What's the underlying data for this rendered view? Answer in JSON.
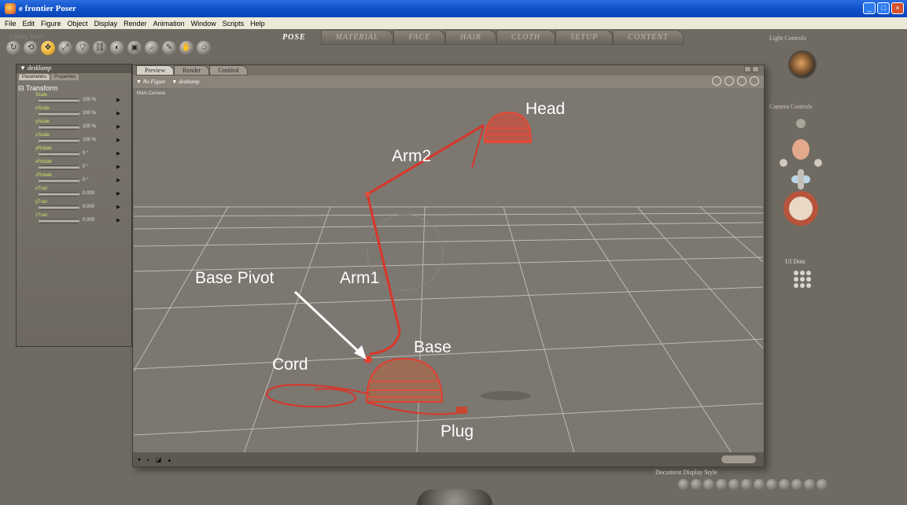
{
  "window": {
    "title": "e frontier Poser"
  },
  "menu": [
    "File",
    "Edit",
    "Figure",
    "Object",
    "Display",
    "Render",
    "Animation",
    "Window",
    "Scripts",
    "Help"
  ],
  "toolbar": {
    "label": "Editing Tools",
    "tools": [
      "rotate",
      "twist",
      "translate",
      "scale",
      "taper",
      "chain-break",
      "color",
      "grouping",
      "view-magnifier",
      "morphing",
      "direct-manipulation",
      "figure"
    ]
  },
  "rooms": [
    "POSE",
    "MATERIAL",
    "FACE",
    "HAIR",
    "CLOTH",
    "SETUP",
    "CONTENT"
  ],
  "active_room": "POSE",
  "parameters": {
    "actor": "desklamp",
    "tabs": [
      "Parameters",
      "Properties"
    ],
    "group": "Transform",
    "dials": [
      {
        "label": "Scale",
        "value": "100 %"
      },
      {
        "label": "xScale",
        "value": "100 %"
      },
      {
        "label": "yScale",
        "value": "100 %"
      },
      {
        "label": "zScale",
        "value": "100 %"
      },
      {
        "label": "yRotate",
        "value": "0 °"
      },
      {
        "label": "xRotate",
        "value": "0 °"
      },
      {
        "label": "zRotate",
        "value": "0 °"
      },
      {
        "label": "xTran",
        "value": "0.000"
      },
      {
        "label": "yTran",
        "value": "0.000"
      },
      {
        "label": "zTran",
        "value": "0.000"
      }
    ]
  },
  "document": {
    "tabs": [
      "Preview",
      "Render",
      "Untitled"
    ],
    "figure_select": "No Figure",
    "actor_select": "desklamp",
    "camera": "Main Camera"
  },
  "annotations": {
    "head": "Head",
    "arm2": "Arm2",
    "arm1": "Arm1",
    "base_pivot": "Base Pivot",
    "base": "Base",
    "cord": "Cord",
    "plug": "Plug"
  },
  "right_panel": {
    "light_controls": "Light Controls",
    "camera_controls": "Camera Controls",
    "ui_dots": "UI Dots",
    "document_display_style": "Document Display Style"
  },
  "colors": {
    "lamp": "#d9362a",
    "floor": "#7c7770",
    "grid": "#cfcac2"
  }
}
